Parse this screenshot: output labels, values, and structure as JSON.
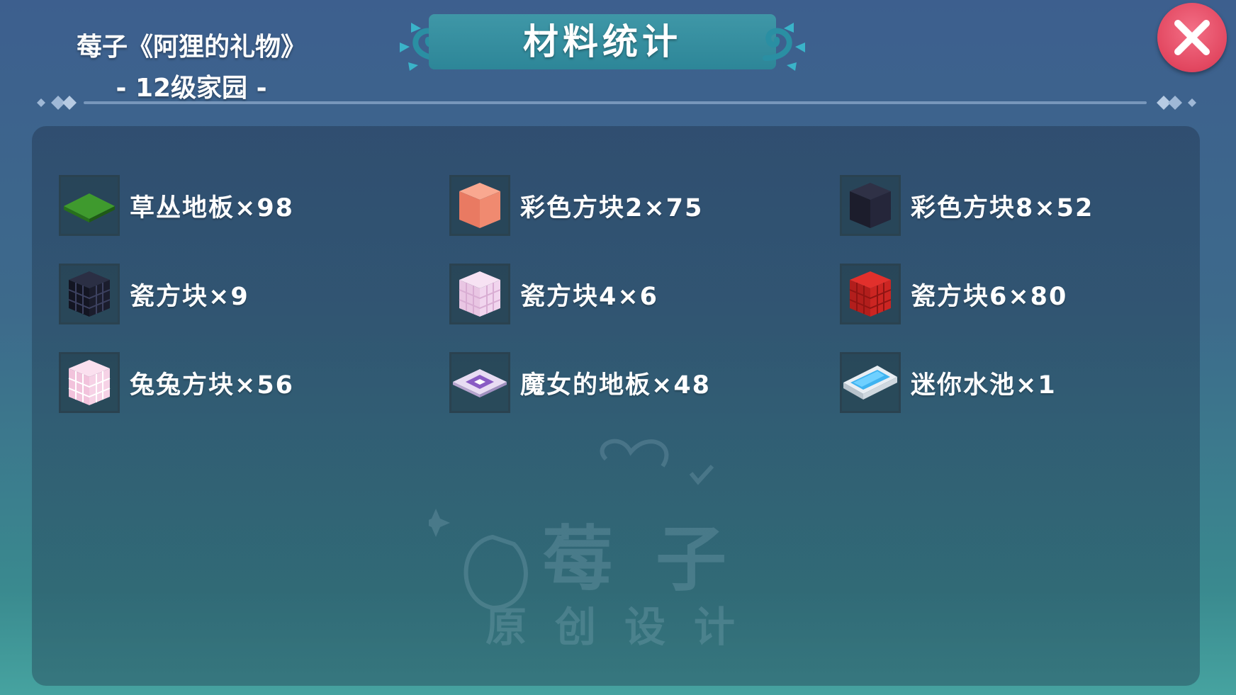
{
  "header": {
    "owner_line": "莓子《阿狸的礼物》",
    "level_line": "- 12级家园 -",
    "title": "材料统计"
  },
  "watermark": {
    "main": "莓子",
    "sub": "原创设计"
  },
  "items": [
    {
      "label": "草丛地板×98",
      "icon": "grass-floor"
    },
    {
      "label": "彩色方块2×75",
      "icon": "color-block-orange"
    },
    {
      "label": "彩色方块8×52",
      "icon": "color-block-dark"
    },
    {
      "label": "瓷方块×9",
      "icon": "tile-block-black"
    },
    {
      "label": "瓷方块4×6",
      "icon": "tile-block-pink"
    },
    {
      "label": "瓷方块6×80",
      "icon": "tile-block-red"
    },
    {
      "label": "兔兔方块×56",
      "icon": "bunny-block"
    },
    {
      "label": "魔女的地板×48",
      "icon": "witch-floor"
    },
    {
      "label": "迷你水池×1",
      "icon": "mini-pool"
    }
  ],
  "colors": {
    "close_button": "#e24760",
    "title_plate": "#3f97a7"
  }
}
